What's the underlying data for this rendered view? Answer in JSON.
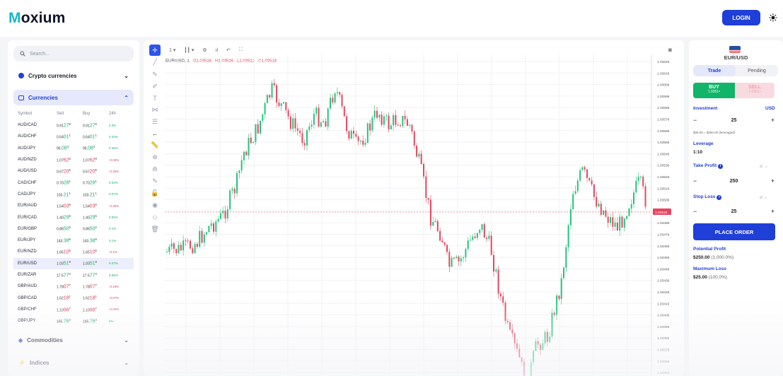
{
  "header": {
    "logo_rest": "oxium",
    "logo_first": "M",
    "login_label": "LOGIN"
  },
  "sidebar": {
    "search_placeholder": "Search...",
    "sections": {
      "crypto": "Crypto currencies",
      "currencies": "Currencies",
      "commodities": "Commodities",
      "indices": "Indices"
    },
    "columns": [
      "Symbol",
      "Sell",
      "Buy",
      "24h"
    ],
    "rows": [
      {
        "symbol": "AUD/CAD",
        "sell": "0.91",
        "sell_big": "27",
        "sell_sup": "5",
        "buy": "0.91",
        "buy_big": "27",
        "buy_sup": "5",
        "change": "0.3%",
        "dir": "up"
      },
      {
        "symbol": "AUD/CHF",
        "sell": "0.64",
        "sell_big": "01",
        "sell_sup": "1",
        "buy": "0.64",
        "buy_big": "01",
        "buy_sup": "1",
        "change": "0.34%",
        "dir": "up"
      },
      {
        "symbol": "AUD/JPY",
        "sell": "95.",
        "sell_big": "08",
        "sell_sup": "4",
        "buy": "95.",
        "buy_big": "08",
        "buy_sup": "4",
        "change": "0.38%",
        "dir": "up"
      },
      {
        "symbol": "AUD/NZD",
        "sell": "1.07",
        "sell_big": "62",
        "sell_sup": "8",
        "buy": "1.07",
        "buy_big": "62",
        "buy_sup": "8",
        "change": "-0.03%",
        "dir": "dn"
      },
      {
        "symbol": "AUD/USD",
        "sell": "0.67",
        "sell_big": "20",
        "sell_sup": "5",
        "buy": "0.67",
        "buy_big": "20",
        "buy_sup": "5",
        "change": "-0.26%",
        "dir": "dn"
      },
      {
        "symbol": "CAD/CHF",
        "sell": "0.70",
        "sell_big": "28",
        "sell_sup": "1",
        "buy": "0.70",
        "buy_big": "28",
        "buy_sup": "1",
        "change": "0.03%",
        "dir": "up"
      },
      {
        "symbol": "CAD/JPY",
        "sell": "103.",
        "sell_big": "21",
        "sell_sup": "1",
        "buy": "103.",
        "buy_big": "21",
        "buy_sup": "1",
        "change": "0.07%",
        "dir": "up"
      },
      {
        "symbol": "EUR/AUD",
        "sell": "1.54",
        "sell_big": "03",
        "sell_sup": "6",
        "buy": "1.54",
        "buy_big": "03",
        "buy_sup": "6",
        "change": "-0.26%",
        "dir": "dn"
      },
      {
        "symbol": "EUR/CAD",
        "sell": "1.40",
        "sell_big": "29",
        "sell_sup": "5",
        "buy": "1.40",
        "buy_big": "29",
        "buy_sup": "5",
        "change": "0.05%",
        "dir": "up"
      },
      {
        "symbol": "EUR/GBP",
        "sell": "0.86",
        "sell_big": "50",
        "sell_sup": "2",
        "buy": "0.86",
        "buy_big": "50",
        "buy_sup": "2",
        "change": "0.1%",
        "dir": "up"
      },
      {
        "symbol": "EUR/JPY",
        "sell": "143.",
        "sell_big": "38",
        "sell_sup": "6",
        "buy": "143.",
        "buy_big": "38",
        "buy_sup": "6",
        "change": "0.1%",
        "dir": "up"
      },
      {
        "symbol": "EUR/NZD",
        "sell": "1.65",
        "sell_big": "10",
        "sell_sup": "5",
        "buy": "1.65",
        "buy_big": "10",
        "buy_sup": "5",
        "change": "-0.1%",
        "dir": "dn"
      },
      {
        "symbol": "EUR/USD",
        "sell": "1.03",
        "sell_big": "51",
        "sell_sup": "8",
        "buy": "1.03",
        "buy_big": "51",
        "buy_sup": "8",
        "change": "0.37%",
        "dir": "up",
        "selected": true
      },
      {
        "symbol": "EUR/ZAR",
        "sell": "17.5",
        "sell_big": "77",
        "sell_sup": "4",
        "buy": "17.5",
        "buy_big": "77",
        "buy_sup": "4",
        "change": "0.55%",
        "dir": "up"
      },
      {
        "symbol": "GBP/AUD",
        "sell": "1.78",
        "sell_big": "07",
        "sell_sup": "7",
        "buy": "1.78",
        "buy_big": "07",
        "buy_sup": "7",
        "change": "-0.16%",
        "dir": "dn"
      },
      {
        "symbol": "GBP/CAD",
        "sell": "1.62",
        "sell_big": "18",
        "sell_sup": "1",
        "buy": "1.62",
        "buy_big": "18",
        "buy_sup": "1",
        "change": "-0.07%",
        "dir": "dn"
      },
      {
        "symbol": "GBP/CHF",
        "sell": "1.10",
        "sell_big": "98",
        "sell_sup": "7",
        "buy": "1.10",
        "buy_big": "98",
        "buy_sup": "7",
        "change": "-0.04%",
        "dir": "dn"
      },
      {
        "symbol": "GBP/JPY",
        "sell": "165.",
        "sell_big": "76",
        "sell_sup": "4",
        "buy": "165.",
        "buy_big": "76",
        "buy_sup": "4",
        "change": "0%",
        "dir": "up"
      }
    ]
  },
  "chart": {
    "interval": "1",
    "symbol_label": "EUR/USD, 1",
    "open": "O1.03526",
    "high": "H1.03526",
    "low": "L1.03512",
    "close": "C1.03518",
    "price_ticks": [
      "1.03626",
      "1.03616",
      "1.03606",
      "1.03596",
      "1.03586",
      "1.03576",
      "1.03566",
      "1.03556",
      "1.03546",
      "1.03536",
      "1.03526",
      "1.03516",
      "1.03506",
      "1.03496",
      "1.03486",
      "1.03476",
      "1.03466",
      "1.03456",
      "1.03446",
      "1.03436",
      "1.03426",
      "1.03416",
      "1.03406",
      "1.03396",
      "1.03386",
      "1.03376",
      "1.03366",
      "1.03356"
    ],
    "last_price": "1.03518",
    "colors": {
      "up": "#22c57a",
      "down": "#e8445e",
      "accent": "#1f3fd8"
    }
  },
  "trade": {
    "pair": "EUR/USD",
    "tabs": [
      "Trade",
      "Pending"
    ],
    "buy_label": "BUY",
    "buy_price": "1.0351⁸",
    "sell_label": "SELL",
    "sell_price": "1.0351⁸",
    "investment_label": "Investment",
    "currency": "USD",
    "investment": "25",
    "leveraged_note": "$25.00 = $250.00 (leveraged)",
    "leverage_label": "Leverage",
    "leverage": "1:10",
    "take_profit_label": "Take Profit",
    "take_profit": "250",
    "stop_loss_label": "Stop Loss",
    "stop_loss": "25",
    "place_order": "PLACE ORDER",
    "potential_profit_label": "Potential Profit",
    "potential_profit": "$250.00",
    "potential_profit_pct": "(1,000.0%)",
    "max_loss_label": "Maximum Loss",
    "max_loss": "$25.00",
    "max_loss_pct": "(100.0%)"
  }
}
